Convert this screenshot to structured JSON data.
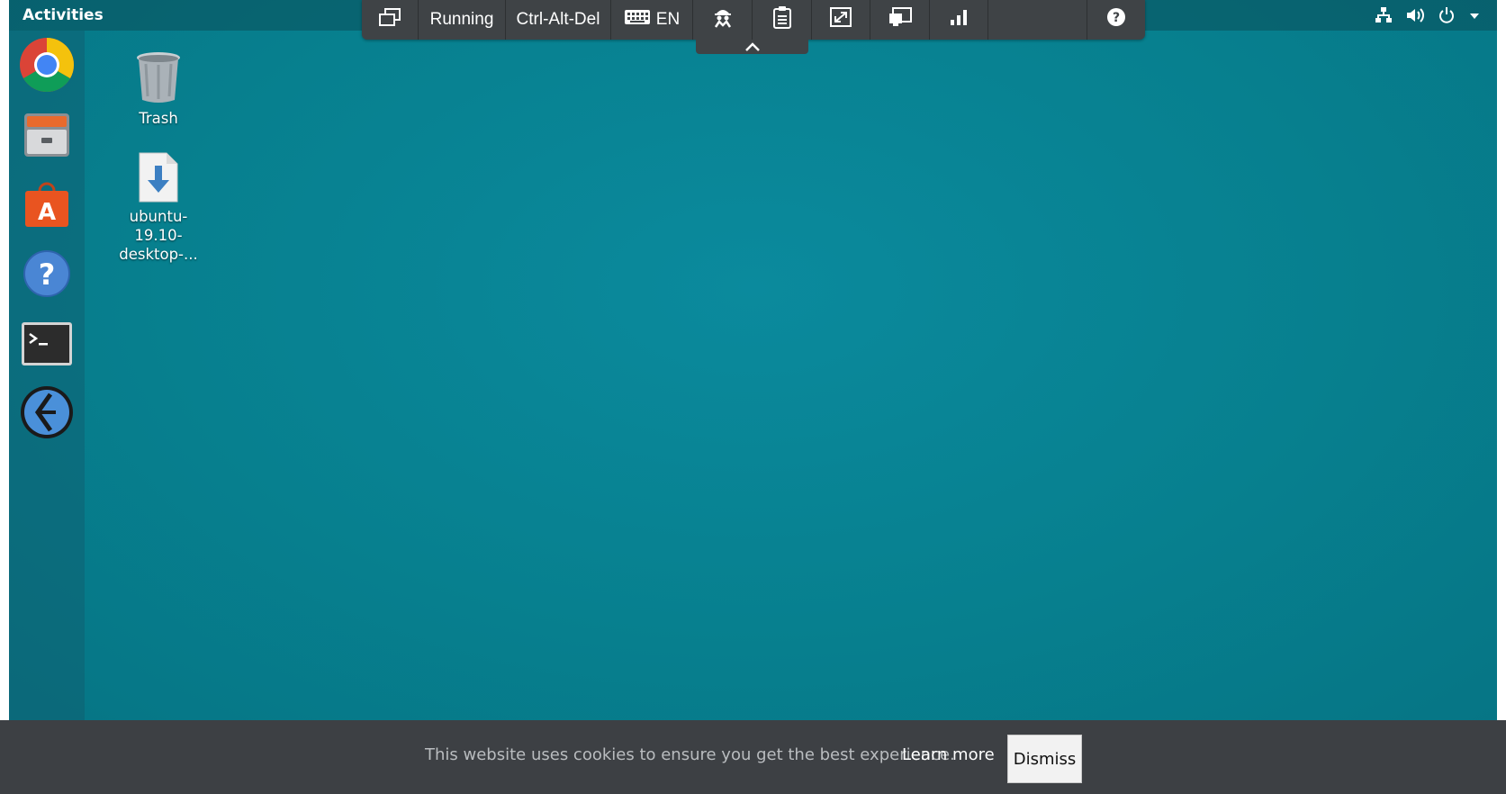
{
  "topbar": {
    "activities": "Activities"
  },
  "remote_toolbar": {
    "running": "Running",
    "ctrl_alt_del": "Ctrl-Alt-Del",
    "keyboard_lang": "EN"
  },
  "desktop_icons": {
    "trash": "Trash",
    "file_line1": "ubuntu-",
    "file_line2": "19.10-",
    "file_line3": "desktop-..."
  },
  "dock": {
    "icons": [
      "chrome-icon",
      "files-icon",
      "software-center-icon",
      "help-icon",
      "terminal-icon",
      "remmina-icon"
    ]
  },
  "cookie_bar": {
    "message": "This website uses cookies to ensure you get the best experience.",
    "learn_more": "Learn more",
    "dismiss": "Dismiss"
  },
  "colors": {
    "desktop": "#07808f",
    "toolbar": "#3f4346",
    "cookie_bar": "#3d4044"
  }
}
